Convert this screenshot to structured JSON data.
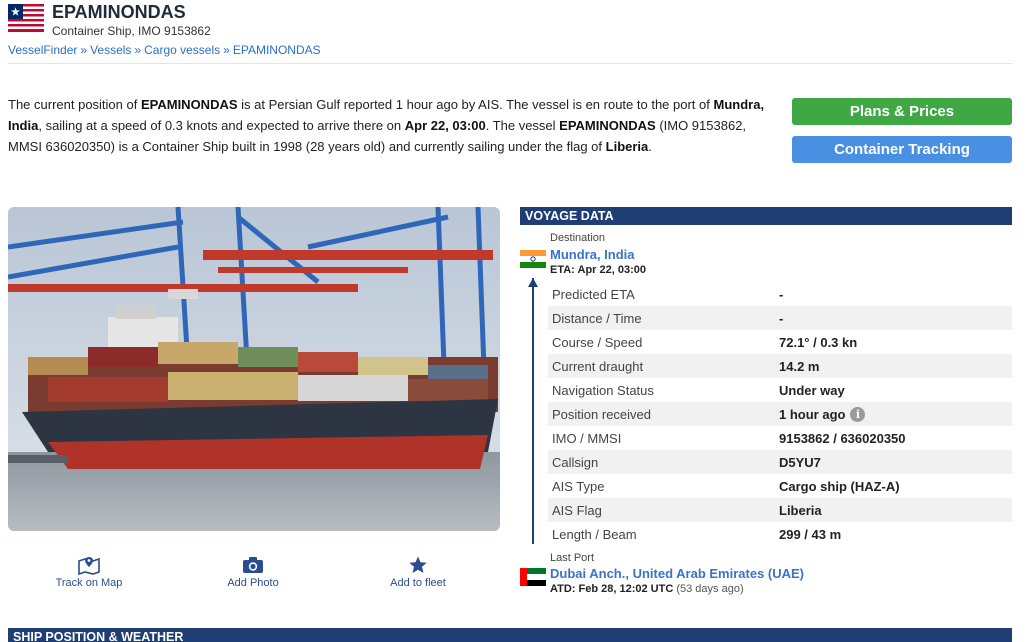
{
  "vessel": {
    "name": "EPAMINONDAS",
    "subtitle": "Container Ship, IMO 9153862",
    "flag_icon": "liberia-flag-icon"
  },
  "breadcrumb": [
    "VesselFinder",
    "Vessels",
    "Cargo vessels",
    "EPAMINONDAS"
  ],
  "breadcrumb_sep": "»",
  "intro": {
    "p1": "The current position of ",
    "name1": "EPAMINONDAS",
    "p2": " is at Persian Gulf reported 1 hour ago by AIS. The vessel is en route to the port of ",
    "port": "Mundra, India",
    "p3": ", sailing at a speed of 0.3 knots and expected to arrive there on ",
    "eta": "Apr 22, 03:00",
    "p4": ". The vessel ",
    "name2": "EPAMINONDAS",
    "p5": " (IMO 9153862, MMSI 636020350) is a Container Ship built in 1998 (28 years old) and currently sailing under the flag of ",
    "flag": "Liberia",
    "p6": "."
  },
  "buttons": {
    "plans": "Plans & Prices",
    "tracking": "Container Tracking"
  },
  "actions": {
    "track": "Track on Map",
    "photo": "Add Photo",
    "fleet": "Add to fleet"
  },
  "voyage": {
    "header": "VOYAGE DATA",
    "destination_label": "Destination",
    "destination": "Mundra, India",
    "eta": "ETA: Apr 22, 03:00",
    "rows": [
      {
        "k": "Predicted ETA",
        "v": "-"
      },
      {
        "k": "Distance / Time",
        "v": "-"
      },
      {
        "k": "Course / Speed",
        "v": "72.1° / 0.3 kn"
      },
      {
        "k": "Current draught",
        "v": "14.2 m"
      },
      {
        "k": "Navigation Status",
        "v": "Under way"
      },
      {
        "k": "Position received",
        "v": "1 hour ago"
      },
      {
        "k": "IMO / MMSI",
        "v": "9153862 / 636020350"
      },
      {
        "k": "Callsign",
        "v": "D5YU7"
      },
      {
        "k": "AIS Type",
        "v": "Cargo ship (HAZ-A)"
      },
      {
        "k": "AIS Flag",
        "v": "Liberia"
      },
      {
        "k": "Length / Beam",
        "v": "299 / 43 m"
      }
    ],
    "info_glyph": "i",
    "last_port_label": "Last Port",
    "last_port": "Dubai Anch., United Arab Emirates (UAE)",
    "atd": "ATD: Feb 28, 12:02 UTC",
    "atd_ago": "(53 days ago)"
  },
  "bottom_section": "SHIP POSITION & WEATHER",
  "colors": {
    "header_navy": "#1f3e73",
    "link_blue": "#3a73c9",
    "green": "#3fa844",
    "blue": "#4a90e2"
  }
}
